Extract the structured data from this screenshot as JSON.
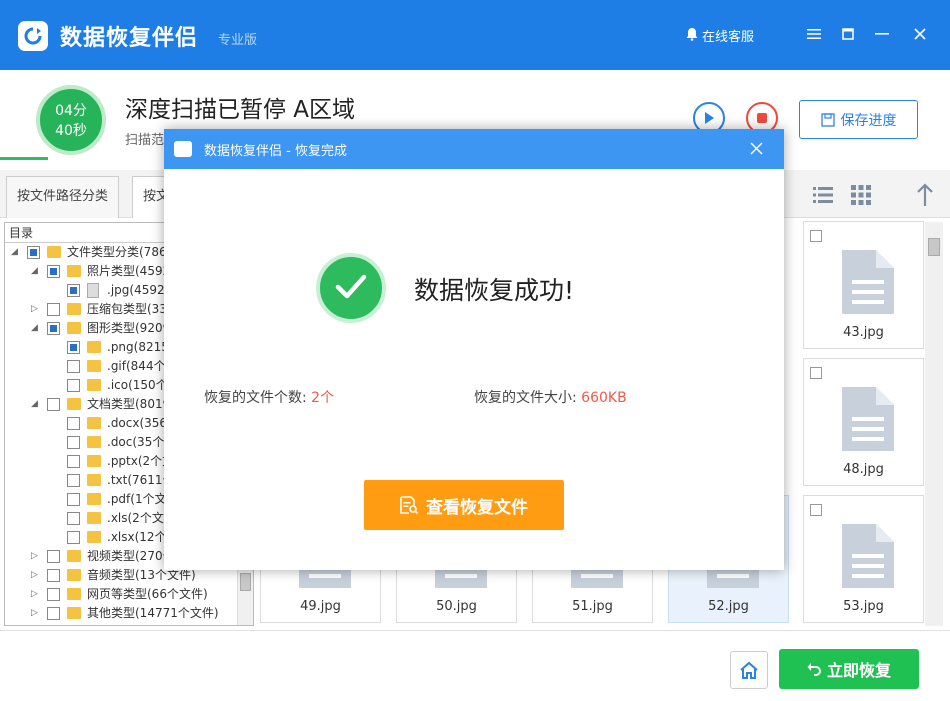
{
  "app": {
    "title": "数据恢复伴侣",
    "edition": "专业版",
    "online_service": "在线客服",
    "brand_color": "#1e7ee6"
  },
  "scan": {
    "timer_min": "04分",
    "timer_sec": "40秒",
    "title": "深度扫描已暂停 A区域",
    "subtitle": "扫描范",
    "save_progress_label": "保存进度"
  },
  "tabs": [
    {
      "label": "按文件路径分类"
    },
    {
      "label": "按文"
    }
  ],
  "tree": {
    "header": "目录",
    "rows": [
      {
        "label": "文件类型分类(786"
      },
      {
        "label": "照片类型(4592"
      },
      {
        "label": ".jpg(4592"
      },
      {
        "label": "压缩包类型(33"
      },
      {
        "label": "图形类型(9209"
      },
      {
        "label": ".png(8215"
      },
      {
        "label": ".gif(844个"
      },
      {
        "label": ".ico(150个"
      },
      {
        "label": "文档类型(8019"
      },
      {
        "label": ".docx(356"
      },
      {
        "label": ".doc(35个"
      },
      {
        "label": ".pptx(2个文"
      },
      {
        "label": ".txt(7611个"
      },
      {
        "label": ".pdf(1个文"
      },
      {
        "label": ".xls(2个文件"
      },
      {
        "label": ".xlsx(12个"
      },
      {
        "label": "视频类型(270个"
      },
      {
        "label": "音频类型(13个文件)"
      },
      {
        "label": "网页等类型(66个文件)"
      },
      {
        "label": "其他类型(14771个文件)"
      }
    ]
  },
  "grid": {
    "cards": [
      {
        "name": "43.jpg"
      },
      {
        "name": "48.jpg"
      },
      {
        "name": "49.jpg"
      },
      {
        "name": "50.jpg"
      },
      {
        "name": "51.jpg"
      },
      {
        "name": "52.jpg"
      },
      {
        "name": "53.jpg"
      }
    ]
  },
  "footer": {
    "recover_label": "立即恢复"
  },
  "modal": {
    "title": "数据恢复伴侣 - 恢复完成",
    "success_text": "数据恢复成功!",
    "count_label": "恢复的文件个数: ",
    "count_value": "2个",
    "size_label": "恢复的文件大小: ",
    "size_value": "660KB",
    "view_button": "查看恢复文件",
    "accent_color": "#ff9c12",
    "success_color": "#2dbb5d"
  }
}
